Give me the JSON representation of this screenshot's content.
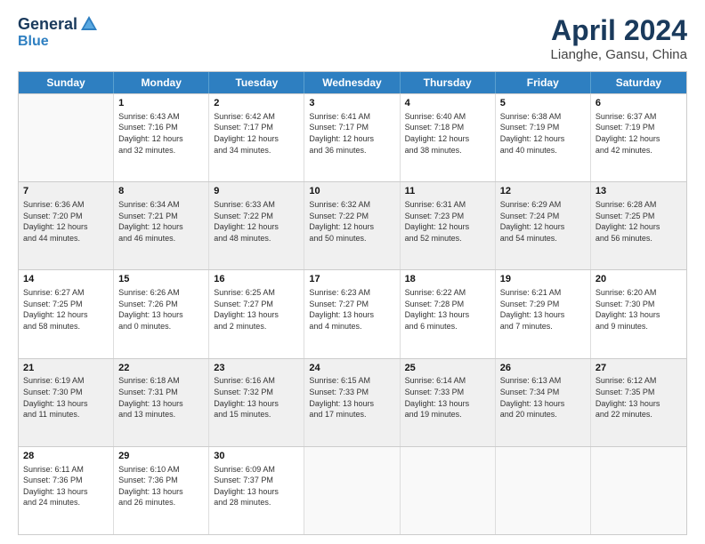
{
  "logo": {
    "general": "General",
    "blue": "Blue"
  },
  "calendar": {
    "title": "April 2024",
    "location": "Lianghe, Gansu, China",
    "days": [
      "Sunday",
      "Monday",
      "Tuesday",
      "Wednesday",
      "Thursday",
      "Friday",
      "Saturday"
    ],
    "rows": [
      [
        {
          "num": "",
          "lines": [],
          "empty": true
        },
        {
          "num": "1",
          "lines": [
            "Sunrise: 6:43 AM",
            "Sunset: 7:16 PM",
            "Daylight: 12 hours",
            "and 32 minutes."
          ]
        },
        {
          "num": "2",
          "lines": [
            "Sunrise: 6:42 AM",
            "Sunset: 7:17 PM",
            "Daylight: 12 hours",
            "and 34 minutes."
          ]
        },
        {
          "num": "3",
          "lines": [
            "Sunrise: 6:41 AM",
            "Sunset: 7:17 PM",
            "Daylight: 12 hours",
            "and 36 minutes."
          ]
        },
        {
          "num": "4",
          "lines": [
            "Sunrise: 6:40 AM",
            "Sunset: 7:18 PM",
            "Daylight: 12 hours",
            "and 38 minutes."
          ]
        },
        {
          "num": "5",
          "lines": [
            "Sunrise: 6:38 AM",
            "Sunset: 7:19 PM",
            "Daylight: 12 hours",
            "and 40 minutes."
          ]
        },
        {
          "num": "6",
          "lines": [
            "Sunrise: 6:37 AM",
            "Sunset: 7:19 PM",
            "Daylight: 12 hours",
            "and 42 minutes."
          ]
        }
      ],
      [
        {
          "num": "7",
          "lines": [
            "Sunrise: 6:36 AM",
            "Sunset: 7:20 PM",
            "Daylight: 12 hours",
            "and 44 minutes."
          ],
          "shaded": true
        },
        {
          "num": "8",
          "lines": [
            "Sunrise: 6:34 AM",
            "Sunset: 7:21 PM",
            "Daylight: 12 hours",
            "and 46 minutes."
          ],
          "shaded": true
        },
        {
          "num": "9",
          "lines": [
            "Sunrise: 6:33 AM",
            "Sunset: 7:22 PM",
            "Daylight: 12 hours",
            "and 48 minutes."
          ],
          "shaded": true
        },
        {
          "num": "10",
          "lines": [
            "Sunrise: 6:32 AM",
            "Sunset: 7:22 PM",
            "Daylight: 12 hours",
            "and 50 minutes."
          ],
          "shaded": true
        },
        {
          "num": "11",
          "lines": [
            "Sunrise: 6:31 AM",
            "Sunset: 7:23 PM",
            "Daylight: 12 hours",
            "and 52 minutes."
          ],
          "shaded": true
        },
        {
          "num": "12",
          "lines": [
            "Sunrise: 6:29 AM",
            "Sunset: 7:24 PM",
            "Daylight: 12 hours",
            "and 54 minutes."
          ],
          "shaded": true
        },
        {
          "num": "13",
          "lines": [
            "Sunrise: 6:28 AM",
            "Sunset: 7:25 PM",
            "Daylight: 12 hours",
            "and 56 minutes."
          ],
          "shaded": true
        }
      ],
      [
        {
          "num": "14",
          "lines": [
            "Sunrise: 6:27 AM",
            "Sunset: 7:25 PM",
            "Daylight: 12 hours",
            "and 58 minutes."
          ]
        },
        {
          "num": "15",
          "lines": [
            "Sunrise: 6:26 AM",
            "Sunset: 7:26 PM",
            "Daylight: 13 hours",
            "and 0 minutes."
          ]
        },
        {
          "num": "16",
          "lines": [
            "Sunrise: 6:25 AM",
            "Sunset: 7:27 PM",
            "Daylight: 13 hours",
            "and 2 minutes."
          ]
        },
        {
          "num": "17",
          "lines": [
            "Sunrise: 6:23 AM",
            "Sunset: 7:27 PM",
            "Daylight: 13 hours",
            "and 4 minutes."
          ]
        },
        {
          "num": "18",
          "lines": [
            "Sunrise: 6:22 AM",
            "Sunset: 7:28 PM",
            "Daylight: 13 hours",
            "and 6 minutes."
          ]
        },
        {
          "num": "19",
          "lines": [
            "Sunrise: 6:21 AM",
            "Sunset: 7:29 PM",
            "Daylight: 13 hours",
            "and 7 minutes."
          ]
        },
        {
          "num": "20",
          "lines": [
            "Sunrise: 6:20 AM",
            "Sunset: 7:30 PM",
            "Daylight: 13 hours",
            "and 9 minutes."
          ]
        }
      ],
      [
        {
          "num": "21",
          "lines": [
            "Sunrise: 6:19 AM",
            "Sunset: 7:30 PM",
            "Daylight: 13 hours",
            "and 11 minutes."
          ],
          "shaded": true
        },
        {
          "num": "22",
          "lines": [
            "Sunrise: 6:18 AM",
            "Sunset: 7:31 PM",
            "Daylight: 13 hours",
            "and 13 minutes."
          ],
          "shaded": true
        },
        {
          "num": "23",
          "lines": [
            "Sunrise: 6:16 AM",
            "Sunset: 7:32 PM",
            "Daylight: 13 hours",
            "and 15 minutes."
          ],
          "shaded": true
        },
        {
          "num": "24",
          "lines": [
            "Sunrise: 6:15 AM",
            "Sunset: 7:33 PM",
            "Daylight: 13 hours",
            "and 17 minutes."
          ],
          "shaded": true
        },
        {
          "num": "25",
          "lines": [
            "Sunrise: 6:14 AM",
            "Sunset: 7:33 PM",
            "Daylight: 13 hours",
            "and 19 minutes."
          ],
          "shaded": true
        },
        {
          "num": "26",
          "lines": [
            "Sunrise: 6:13 AM",
            "Sunset: 7:34 PM",
            "Daylight: 13 hours",
            "and 20 minutes."
          ],
          "shaded": true
        },
        {
          "num": "27",
          "lines": [
            "Sunrise: 6:12 AM",
            "Sunset: 7:35 PM",
            "Daylight: 13 hours",
            "and 22 minutes."
          ],
          "shaded": true
        }
      ],
      [
        {
          "num": "28",
          "lines": [
            "Sunrise: 6:11 AM",
            "Sunset: 7:36 PM",
            "Daylight: 13 hours",
            "and 24 minutes."
          ]
        },
        {
          "num": "29",
          "lines": [
            "Sunrise: 6:10 AM",
            "Sunset: 7:36 PM",
            "Daylight: 13 hours",
            "and 26 minutes."
          ]
        },
        {
          "num": "30",
          "lines": [
            "Sunrise: 6:09 AM",
            "Sunset: 7:37 PM",
            "Daylight: 13 hours",
            "and 28 minutes."
          ]
        },
        {
          "num": "",
          "lines": [],
          "empty": true
        },
        {
          "num": "",
          "lines": [],
          "empty": true
        },
        {
          "num": "",
          "lines": [],
          "empty": true
        },
        {
          "num": "",
          "lines": [],
          "empty": true
        }
      ]
    ]
  }
}
